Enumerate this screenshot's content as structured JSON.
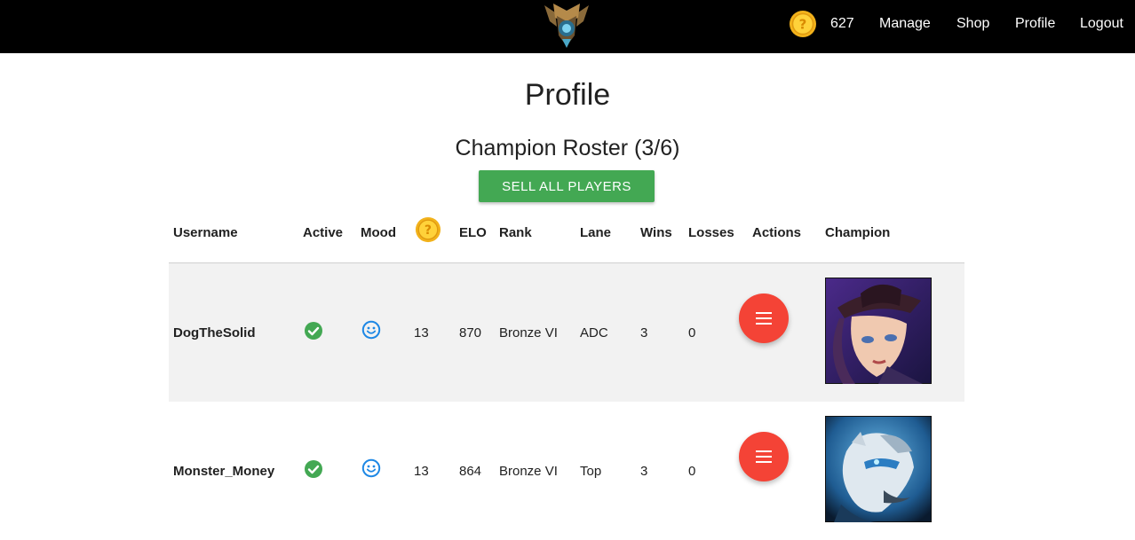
{
  "nav": {
    "coins": "627",
    "links": [
      "Manage",
      "Shop",
      "Profile",
      "Logout"
    ],
    "logo_icon": "rank-crest-icon",
    "coin_icon": "gold-coin-icon"
  },
  "page": {
    "title": "Profile",
    "roster_title": "Champion Roster (3/6)",
    "sell_all_label": "SELL ALL PLAYERS"
  },
  "table": {
    "columns": [
      "Username",
      "Active",
      "Mood",
      "",
      "ELO",
      "Rank",
      "Lane",
      "Wins",
      "Losses",
      "Actions",
      "Champion"
    ],
    "coin_column_icon": "gold-coin-icon",
    "rows": [
      {
        "username": "DogTheSolid",
        "active_icon": "check-circle-icon",
        "mood_icon": "smiley-face-icon",
        "coins": "13",
        "elo": "870",
        "rank": "Bronze VI",
        "lane": "ADC",
        "wins": "3",
        "losses": "0",
        "action_icon": "menu-icon",
        "champion_image": "champion-portrait-caitlyn"
      },
      {
        "username": "Monster_Money",
        "active_icon": "check-circle-icon",
        "mood_icon": "smiley-face-icon",
        "coins": "13",
        "elo": "864",
        "rank": "Bronze VI",
        "lane": "Top",
        "wins": "3",
        "losses": "0",
        "action_icon": "menu-icon",
        "champion_image": "champion-portrait-volibear"
      }
    ]
  },
  "colors": {
    "navbar": "#000000",
    "sell_button": "#43a853",
    "action_button": "#f44336",
    "check": "#43a853",
    "mood": "#1e88e5",
    "row_alt": "#f2f2f2"
  }
}
